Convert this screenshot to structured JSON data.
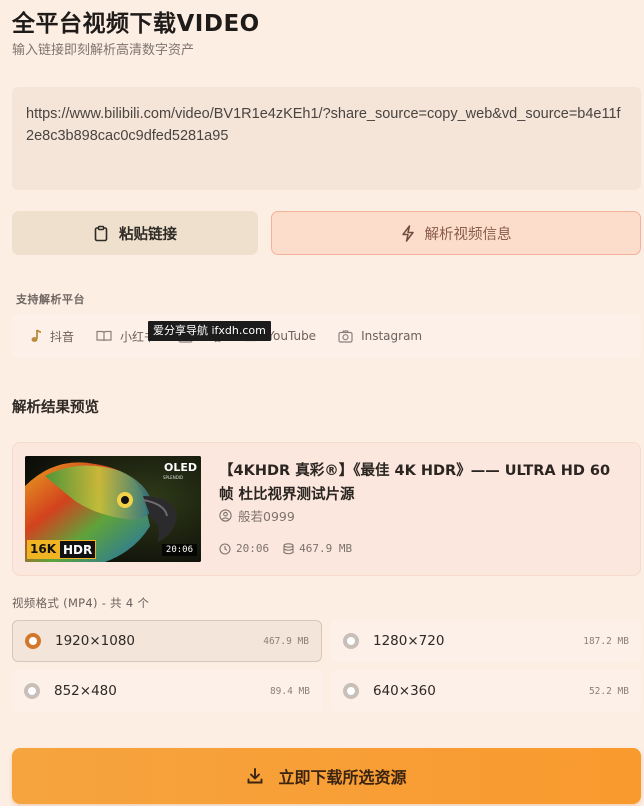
{
  "header": {
    "title": "全平台视频下载VIDEO",
    "subtitle": "输入链接即刻解析高清数字资产"
  },
  "input": {
    "url_value": "https://www.bilibili.com/video/BV1R1e4zKEh1/?share_source=copy_web&vd_source=b4e11f2e8c3b898cac0c9dfed5281a95"
  },
  "actions": {
    "paste_label": "粘贴链接",
    "parse_label": "解析视频信息"
  },
  "platforms": {
    "heading": "支持解析平台",
    "items": [
      {
        "label": "抖音",
        "icon": "music-note-icon"
      },
      {
        "label": "小红书",
        "icon": "book-icon"
      },
      {
        "label": "B站",
        "icon": "tv-icon"
      },
      {
        "label": "YouTube",
        "icon": "video-icon"
      },
      {
        "label": "Instagram",
        "icon": "camera-icon"
      }
    ]
  },
  "watermark": {
    "text": "爱分享导航 ifxdh.com"
  },
  "results": {
    "heading": "解析结果预览",
    "video": {
      "title": "【4KHDR 真彩®】《最佳 4K HDR》—— ULTRA HD 60帧 杜比视界测试片源",
      "uploader": "般若0999",
      "duration": "20:06",
      "size": "467.9 MB",
      "thumb_badge_left": "16K",
      "thumb_badge_right": "HDR",
      "thumb_brand": "OLED",
      "thumb_time": "20:06"
    }
  },
  "formats": {
    "heading": "视频格式 (MP4) - 共 4 个",
    "items": [
      {
        "resolution": "1920×1080",
        "size": "467.9 MB",
        "selected": true
      },
      {
        "resolution": "1280×720",
        "size": "187.2 MB",
        "selected": false
      },
      {
        "resolution": "852×480",
        "size": "89.4 MB",
        "selected": false
      },
      {
        "resolution": "640×360",
        "size": "52.2 MB",
        "selected": false
      }
    ]
  },
  "download": {
    "label": "立即下载所选资源"
  },
  "colors": {
    "accent": "#f6a43f",
    "background": "#fdeee4"
  }
}
